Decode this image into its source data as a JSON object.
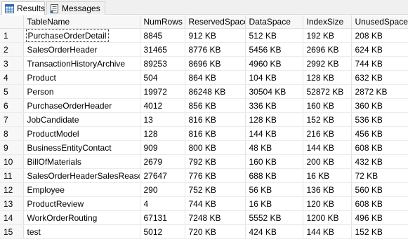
{
  "tabs": {
    "results_label": "Results",
    "messages_label": "Messages"
  },
  "columns": [
    "",
    "TableName",
    "NumRows",
    "ReservedSpace",
    "DataSpace",
    "IndexSize",
    "UnusedSpace"
  ],
  "rows": [
    {
      "num": "1",
      "TableName": "PurchaseOrderDetail",
      "NumRows": "8845",
      "ReservedSpace": "912 KB",
      "DataSpace": "512 KB",
      "IndexSize": "192 KB",
      "UnusedSpace": "208 KB"
    },
    {
      "num": "2",
      "TableName": "SalesOrderHeader",
      "NumRows": "31465",
      "ReservedSpace": "8776 KB",
      "DataSpace": "5456 KB",
      "IndexSize": "2696 KB",
      "UnusedSpace": "624 KB"
    },
    {
      "num": "3",
      "TableName": "TransactionHistoryArchive",
      "NumRows": "89253",
      "ReservedSpace": "8696 KB",
      "DataSpace": "4960 KB",
      "IndexSize": "2992 KB",
      "UnusedSpace": "744 KB"
    },
    {
      "num": "4",
      "TableName": "Product",
      "NumRows": "504",
      "ReservedSpace": "864 KB",
      "DataSpace": "104 KB",
      "IndexSize": "128 KB",
      "UnusedSpace": "632 KB"
    },
    {
      "num": "5",
      "TableName": "Person",
      "NumRows": "19972",
      "ReservedSpace": "86248 KB",
      "DataSpace": "30504 KB",
      "IndexSize": "52872 KB",
      "UnusedSpace": "2872 KB"
    },
    {
      "num": "6",
      "TableName": "PurchaseOrderHeader",
      "NumRows": "4012",
      "ReservedSpace": "856 KB",
      "DataSpace": "336 KB",
      "IndexSize": "160 KB",
      "UnusedSpace": "360 KB"
    },
    {
      "num": "7",
      "TableName": "JobCandidate",
      "NumRows": "13",
      "ReservedSpace": "816 KB",
      "DataSpace": "128 KB",
      "IndexSize": "152 KB",
      "UnusedSpace": "536 KB"
    },
    {
      "num": "8",
      "TableName": "ProductModel",
      "NumRows": "128",
      "ReservedSpace": "816 KB",
      "DataSpace": "144 KB",
      "IndexSize": "216 KB",
      "UnusedSpace": "456 KB"
    },
    {
      "num": "9",
      "TableName": "BusinessEntityContact",
      "NumRows": "909",
      "ReservedSpace": "800 KB",
      "DataSpace": "48 KB",
      "IndexSize": "144 KB",
      "UnusedSpace": "608 KB"
    },
    {
      "num": "10",
      "TableName": "BillOfMaterials",
      "NumRows": "2679",
      "ReservedSpace": "792 KB",
      "DataSpace": "160 KB",
      "IndexSize": "200 KB",
      "UnusedSpace": "432 KB"
    },
    {
      "num": "11",
      "TableName": "SalesOrderHeaderSalesReason",
      "NumRows": "27647",
      "ReservedSpace": "776 KB",
      "DataSpace": "688 KB",
      "IndexSize": "16 KB",
      "UnusedSpace": "72 KB"
    },
    {
      "num": "12",
      "TableName": "Employee",
      "NumRows": "290",
      "ReservedSpace": "752 KB",
      "DataSpace": "56 KB",
      "IndexSize": "136 KB",
      "UnusedSpace": "560 KB"
    },
    {
      "num": "13",
      "TableName": "ProductReview",
      "NumRows": "4",
      "ReservedSpace": "744 KB",
      "DataSpace": "16 KB",
      "IndexSize": "120 KB",
      "UnusedSpace": "608 KB"
    },
    {
      "num": "14",
      "TableName": "WorkOrderRouting",
      "NumRows": "67131",
      "ReservedSpace": "7248 KB",
      "DataSpace": "5552 KB",
      "IndexSize": "1200 KB",
      "UnusedSpace": "496 KB"
    },
    {
      "num": "15",
      "TableName": "test",
      "NumRows": "5012",
      "ReservedSpace": "720 KB",
      "DataSpace": "424 KB",
      "IndexSize": "144 KB",
      "UnusedSpace": "152 KB"
    }
  ],
  "selected_row": 0,
  "icons": {
    "results": "grid-table-icon",
    "messages": "messages-icon"
  },
  "colors": {
    "grid_icon_blue": "#2b6cb0",
    "header_bg": "#f7f7f7",
    "tabbar_bg": "#f0f0f0"
  }
}
